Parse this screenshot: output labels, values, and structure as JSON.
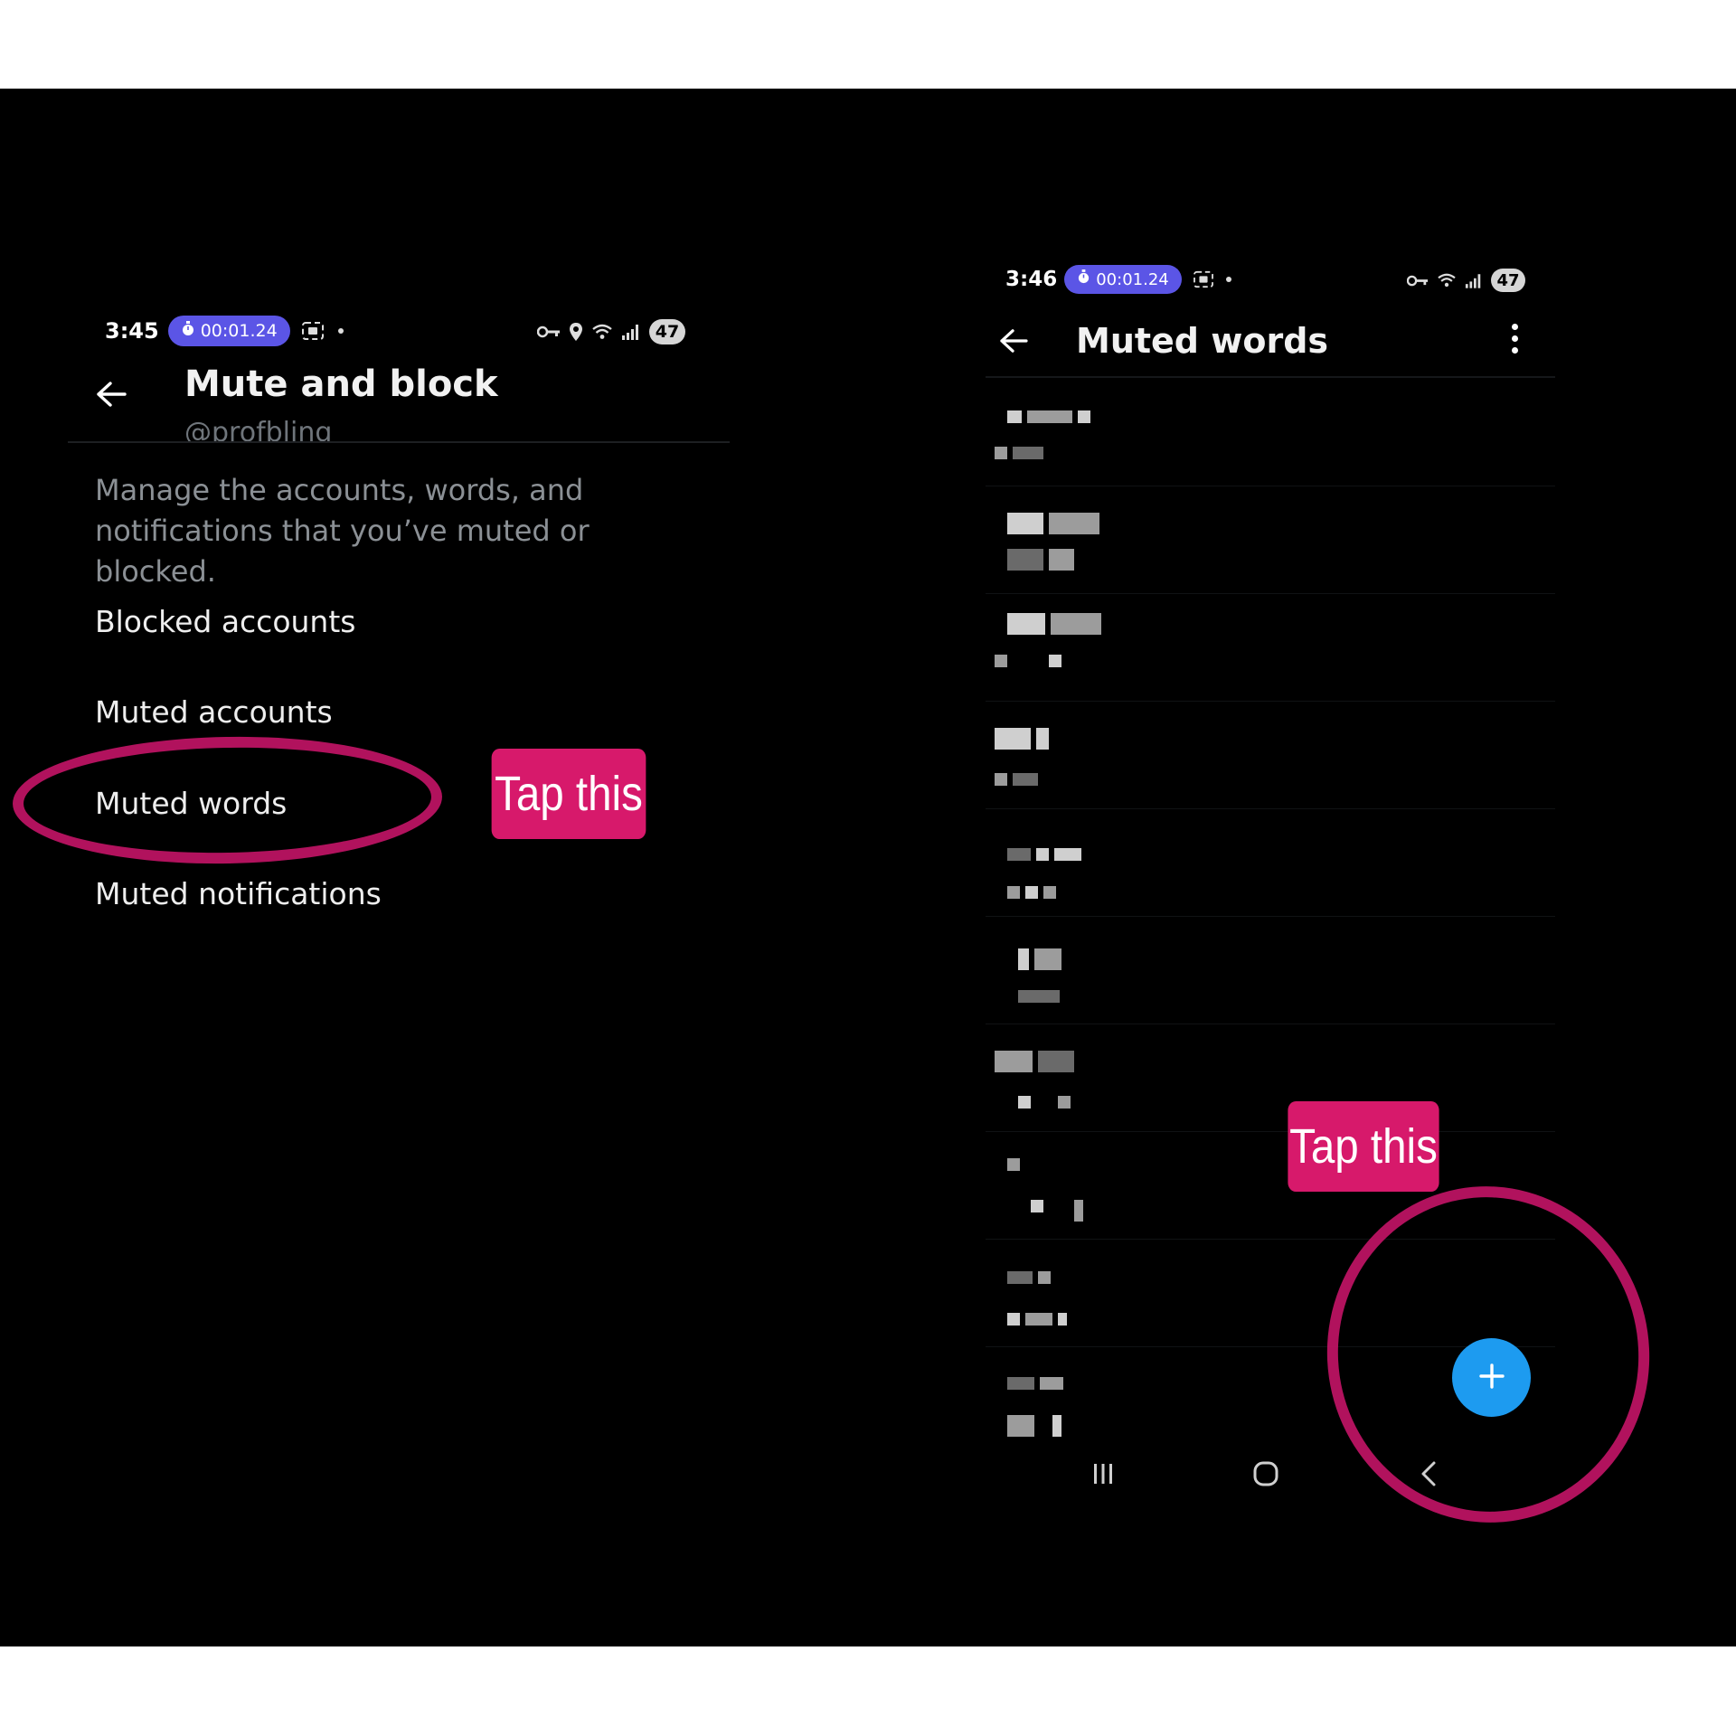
{
  "left_screen": {
    "status_bar": {
      "time": "3:45",
      "timer": "00:01.24",
      "battery": "47",
      "icons": [
        "stopwatch-icon",
        "screen-record-icon",
        "dot-icon",
        "vpn-key-icon",
        "location-icon",
        "wifi-icon",
        "signal-icon"
      ]
    },
    "header": {
      "title": "Mute and block",
      "handle": "@profbling"
    },
    "description": "Manage the accounts, words, and notifications that you’ve muted or blocked.",
    "menu_items": [
      {
        "label": "Blocked accounts"
      },
      {
        "label": "Muted accounts"
      },
      {
        "label": "Muted words"
      },
      {
        "label": "Muted notifications"
      }
    ]
  },
  "right_screen": {
    "status_bar": {
      "time": "3:46",
      "timer": "00:01.24",
      "battery": "47",
      "icons": [
        "stopwatch-icon",
        "screen-record-icon",
        "dot-icon",
        "vpn-key-icon",
        "wifi-icon",
        "signal-icon"
      ]
    },
    "header": {
      "title": "Muted words",
      "menu_icon": "more-vertical-icon"
    },
    "muted_words_pixelated_count": 10,
    "fab_icon": "plus-icon",
    "nav_icons": [
      "recent-apps-icon",
      "home-icon",
      "back-icon"
    ]
  },
  "annotations": {
    "callout_left": "Tap this",
    "callout_right": "Tap this",
    "highlight_color": "#d7196b"
  },
  "colors": {
    "background": "#000000",
    "accent_blue": "#1d9bf0",
    "timer_pill": "#5b55e6"
  }
}
